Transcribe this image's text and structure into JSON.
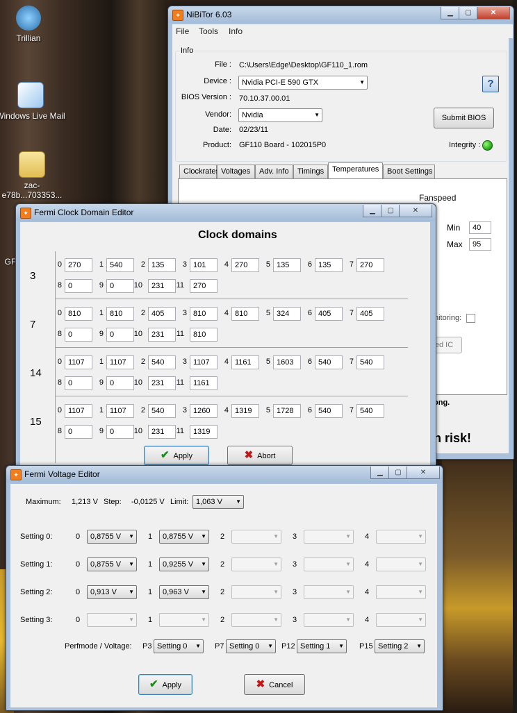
{
  "desktop": {
    "icons": [
      {
        "label": "Trillian"
      },
      {
        "label": "Windows Live Mail"
      },
      {
        "label": "zac-e78b...703353..."
      },
      {
        "label": "GF"
      }
    ]
  },
  "nibitor": {
    "title": "NiBiTor 6.03",
    "menu": [
      "File",
      "Tools",
      "Info"
    ],
    "info_group": "Info",
    "labels": {
      "file": "File :",
      "device": "Device :",
      "bios_version": "BIOS Version :",
      "vendor": "Vendor:",
      "date": "Date:",
      "product": "Product:",
      "integrity": "Integrity :"
    },
    "values": {
      "file": "C:\\Users\\Edge\\Desktop\\GF110_1.rom",
      "device": "Nvidia PCI-E 590 GTX",
      "bios_version": "70.10.37.00.01",
      "vendor": "Nvidia",
      "date": "02/23/11",
      "product": "GF110 Board - 102015P0"
    },
    "submit_label": "Submit BIOS",
    "help_label": "?",
    "integrity_color": "#2db01f",
    "tabs": [
      "Clockrates",
      "Voltages",
      "Adv. Info",
      "Timings",
      "Temperatures",
      "Boot Settings"
    ],
    "active_tab": "Temperatures",
    "fanspeed": {
      "label": "Fanspeed",
      "min_label": "Min",
      "min": "40",
      "max_label": "Max",
      "max": "95"
    },
    "monitoring_label": "nitoring:",
    "ic_label": "ed IC",
    "warning1": "ong.",
    "warning2": "n risk!"
  },
  "clock_editor": {
    "title": "Fermi Clock Domain Editor",
    "heading": "Clock domains",
    "domains": [
      {
        "id": "3",
        "values": [
          "270",
          "540",
          "135",
          "101",
          "270",
          "135",
          "135",
          "270",
          "0",
          "0",
          "231",
          "270"
        ]
      },
      {
        "id": "7",
        "values": [
          "810",
          "810",
          "405",
          "810",
          "810",
          "324",
          "405",
          "405",
          "0",
          "0",
          "231",
          "810"
        ]
      },
      {
        "id": "14",
        "values": [
          "1107",
          "1107",
          "540",
          "1107",
          "1161",
          "1603",
          "540",
          "540",
          "0",
          "0",
          "231",
          "1161"
        ]
      },
      {
        "id": "15",
        "values": [
          "1107",
          "1107",
          "540",
          "1260",
          "1319",
          "1728",
          "540",
          "540",
          "0",
          "0",
          "231",
          "1319"
        ]
      }
    ],
    "apply_label": "Apply",
    "abort_label": "Abort"
  },
  "voltage_editor": {
    "title": "Fermi Voltage Editor",
    "maximum_label": "Maximum:",
    "maximum": "1,213 V",
    "step_label": "Step:",
    "step": "-0,0125 V",
    "limit_label": "Limit:",
    "limit": "1,063 V",
    "settings": [
      {
        "label": "Setting 0:",
        "values": [
          "0,8755 V",
          "0,8755 V",
          "",
          "",
          ""
        ]
      },
      {
        "label": "Setting 1:",
        "values": [
          "0,8755 V",
          "0,9255 V",
          "",
          "",
          ""
        ]
      },
      {
        "label": "Setting 2:",
        "values": [
          "0,913 V",
          "0,963 V",
          "",
          "",
          ""
        ]
      },
      {
        "label": "Setting 3:",
        "values": [
          "",
          "",
          "",
          "",
          ""
        ]
      }
    ],
    "perf_label": "Perfmode / Voltage:",
    "perfmodes": [
      {
        "name": "P3",
        "value": "Setting 0"
      },
      {
        "name": "P7",
        "value": "Setting 0"
      },
      {
        "name": "P12",
        "value": "Setting 1"
      },
      {
        "name": "P15",
        "value": "Setting 2"
      }
    ],
    "apply_label": "Apply",
    "cancel_label": "Cancel"
  }
}
